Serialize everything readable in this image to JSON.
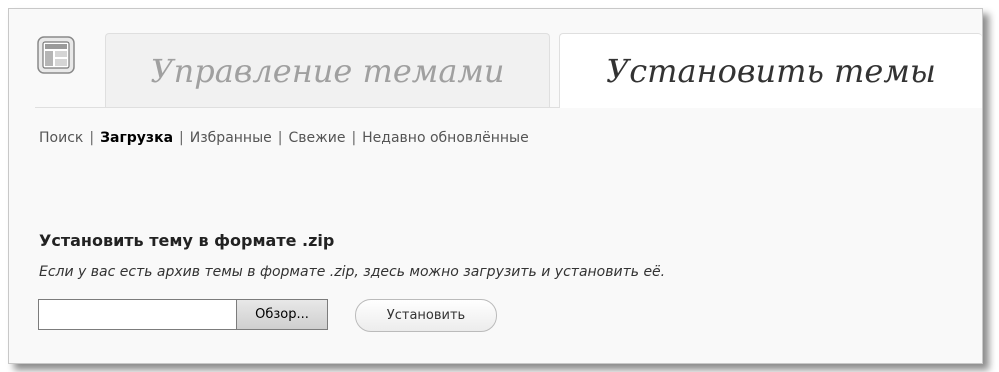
{
  "tabs": [
    {
      "label": "Управление темами",
      "active": false
    },
    {
      "label": "Установить темы",
      "active": true
    }
  ],
  "subnav": [
    {
      "label": "Поиск",
      "current": false
    },
    {
      "label": "Загрузка",
      "current": true
    },
    {
      "label": "Избранные",
      "current": false
    },
    {
      "label": "Свежие",
      "current": false
    },
    {
      "label": "Недавно обновлённые",
      "current": false
    }
  ],
  "subnav_separator": "|",
  "upload": {
    "title": "Установить тему в формате .zip",
    "description": "Если у вас есть архив темы в формате .zip, здесь можно загрузить и установить её.",
    "file_value": "",
    "browse_label": "Обзор...",
    "install_label": "Установить"
  },
  "icons": {
    "header_icon": "appearance-layout-icon"
  },
  "colors": {
    "active_tab_bg": "#ffffff",
    "inactive_tab_bg": "#f1f1f1",
    "inactive_tab_text": "#a0a0a0",
    "page_bg": "#f9f9f9"
  }
}
